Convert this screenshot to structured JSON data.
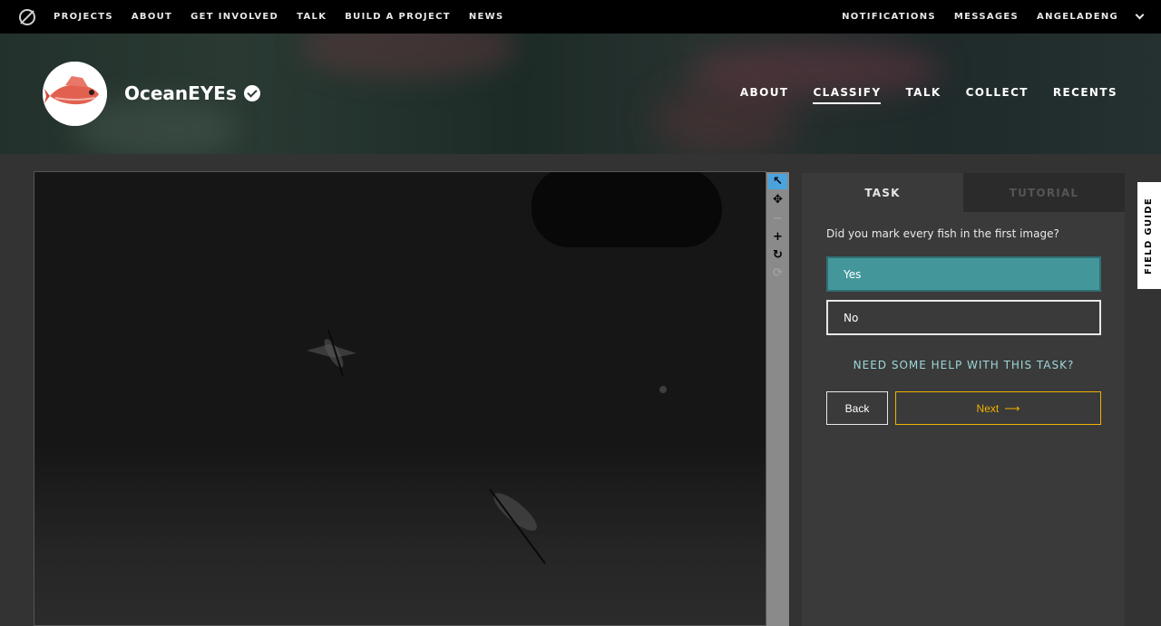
{
  "topbar": {
    "nav": [
      "PROJECTS",
      "ABOUT",
      "GET INVOLVED",
      "TALK",
      "BUILD A PROJECT",
      "NEWS"
    ],
    "notifications": "NOTIFICATIONS",
    "messages": "MESSAGES",
    "user": "ANGELADENG"
  },
  "project": {
    "title": "OceanEYEs",
    "nav": {
      "about": "ABOUT",
      "classify": "CLASSIFY",
      "talk": "TALK",
      "collect": "COLLECT",
      "recents": "RECENTS"
    }
  },
  "viewer": {
    "tools": [
      "pointer-icon",
      "move-icon",
      "zoom-out-icon",
      "zoom-in-icon",
      "rotate-icon",
      "reset-icon"
    ]
  },
  "panel": {
    "tabs": {
      "task": "TASK",
      "tutorial": "TUTORIAL"
    },
    "question": "Did you mark every fish in the first image?",
    "answers": {
      "yes": "Yes",
      "no": "No"
    },
    "help": "NEED SOME HELP WITH THIS TASK?",
    "back": "Back",
    "next": "Next",
    "next_arrow": "⟶"
  },
  "field_guide": "FIELD GUIDE",
  "colors": {
    "accent_teal": "#43979b",
    "next_gold": "#f0b200",
    "tool_active": "#4aa3df"
  }
}
